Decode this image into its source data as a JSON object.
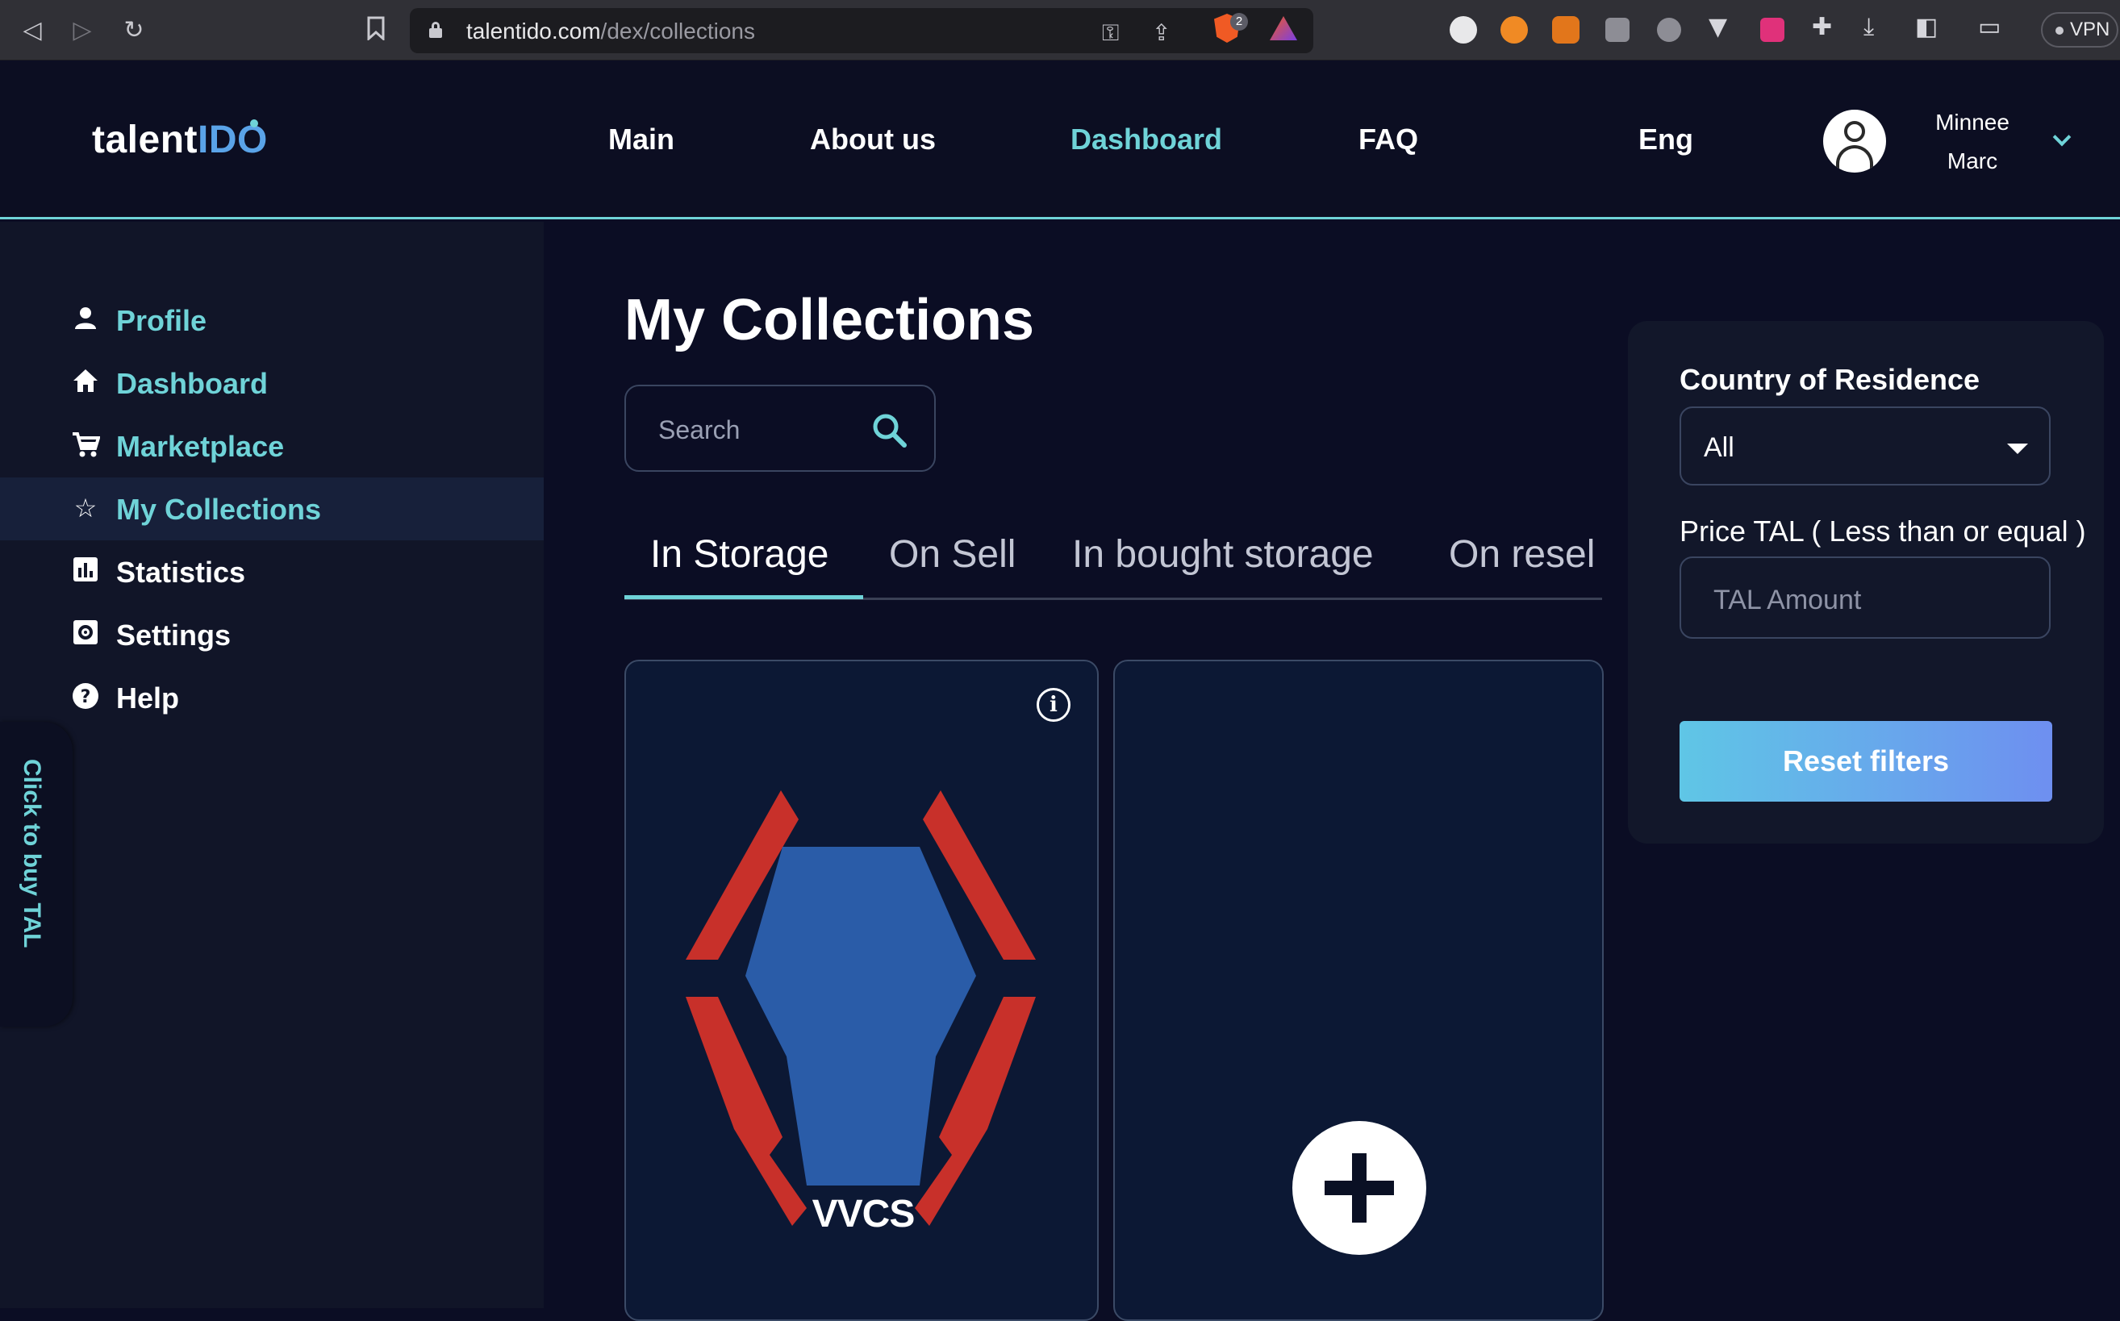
{
  "browser": {
    "url_host": "talentido.com",
    "url_path": "/dex/collections",
    "shields_count": "2",
    "vpn_label": "VPN",
    "icons": [
      "back-icon",
      "forward-icon",
      "reload-icon",
      "bookmark-icon",
      "lock-icon",
      "key-icon",
      "share-icon",
      "brave-shields-icon",
      "brave-rewards-icon",
      "extensions-icon",
      "download-icon",
      "sidebar-icon",
      "wallet-icon"
    ]
  },
  "header": {
    "logo_main": "talent",
    "logo_accent": "IDO",
    "nav": [
      {
        "label": "Main",
        "active": false
      },
      {
        "label": "About us",
        "active": false
      },
      {
        "label": "Dashboard",
        "active": true
      },
      {
        "label": "FAQ",
        "active": false
      }
    ],
    "language": "Eng",
    "user_first": "Minnee",
    "user_last": "Marc"
  },
  "sidebar": {
    "items": [
      {
        "label": "Profile",
        "icon": "person-icon"
      },
      {
        "label": "Dashboard",
        "icon": "home-icon"
      },
      {
        "label": "Marketplace",
        "icon": "cart-icon"
      },
      {
        "label": "My Collections",
        "icon": "star-icon",
        "active": true
      },
      {
        "label": "Statistics",
        "icon": "bar-chart-icon"
      },
      {
        "label": "Settings",
        "icon": "gear-icon"
      },
      {
        "label": "Help",
        "icon": "help-icon"
      }
    ],
    "buy_tab": "Click to buy TAL"
  },
  "main": {
    "title": "My Collections",
    "search_placeholder": "Search",
    "tabs": [
      {
        "label": "In Storage",
        "active": true
      },
      {
        "label": "On Sell"
      },
      {
        "label": "In bought storage"
      },
      {
        "label": "On resel"
      }
    ],
    "cards": [
      {
        "name": "VVCS"
      },
      {
        "type": "add"
      }
    ]
  },
  "filters": {
    "country_label": "Country of Residence",
    "country_value": "All",
    "price_label": "Price TAL ( Less than or equal )",
    "price_placeholder": "TAL Amount",
    "reset_label": "Reset filters"
  },
  "colors": {
    "accent": "#6fd3d8",
    "background": "#0b0d24",
    "logo_red": "#c8302a",
    "logo_blue": "#2a5ca8"
  }
}
